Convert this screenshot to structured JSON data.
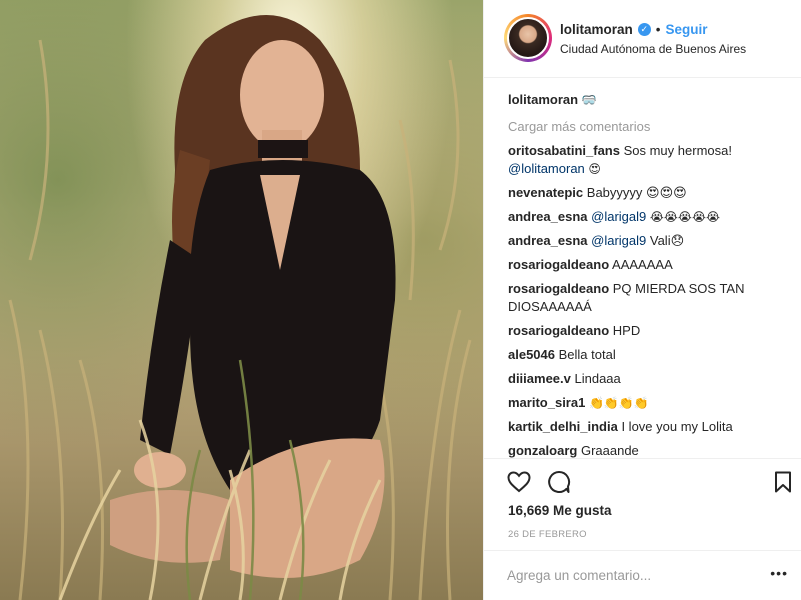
{
  "post": {
    "username": "lolitamoran",
    "verified_icon": "verified-badge-icon",
    "separator": "•",
    "follow_label": "Seguir",
    "location": "Ciudad Autónoma de Buenos Aires",
    "caption_emoji": "🥽"
  },
  "comments_ui": {
    "load_more": "Cargar más comentarios"
  },
  "comments": [
    {
      "user": "oritosabatini_fans",
      "text": "Sos muy hermosa!",
      "line2_mention": "@lolitamoran",
      "line2_emoji": "😍"
    },
    {
      "user": "nevenatepic",
      "text": "Babyyyyy 😍😍😍"
    },
    {
      "user": "andrea_esna",
      "mention": "@larigal9",
      "text": "😭😭😭😭😭"
    },
    {
      "user": "andrea_esna",
      "mention": "@larigal9",
      "text": "Vali😞"
    },
    {
      "user": "rosariogaldeano",
      "text": "AAAAAAA"
    },
    {
      "user": "rosariogaldeano",
      "text": "PQ MIERDA SOS TAN",
      "line2": "DIOSAAAAAÁ"
    },
    {
      "user": "rosariogaldeano",
      "text": "HPD"
    },
    {
      "user": "ale5046",
      "text": "Bella total"
    },
    {
      "user": "diiiamee.v",
      "text": "Lindaaa"
    },
    {
      "user": "marito_sira1",
      "text": "👏👏👏👏"
    },
    {
      "user": "kartik_delhi_india",
      "text": "I love you my Lolita"
    },
    {
      "user": "gonzaloarg",
      "text": "Graaande"
    }
  ],
  "actions": {
    "like_icon": "heart-icon",
    "comment_icon": "comment-bubble-icon",
    "save_icon": "bookmark-icon",
    "likes": "16,669 Me gusta",
    "date": "26 DE FEBRERO"
  },
  "composer": {
    "placeholder": "Agrega un comentario...",
    "more_icon": "more-options-icon",
    "more_glyph": "•••"
  }
}
